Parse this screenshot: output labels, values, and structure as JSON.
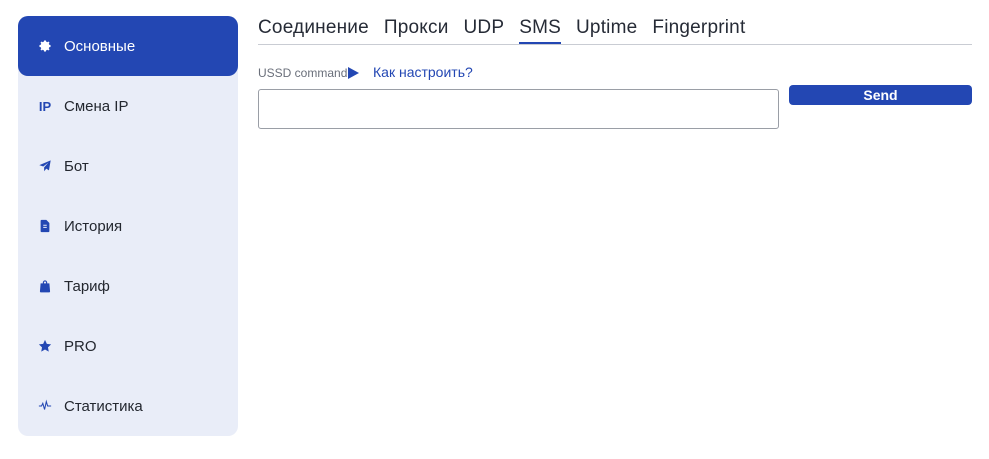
{
  "sidebar": {
    "items": [
      {
        "label": "Основные",
        "icon": "gear-icon",
        "active": true
      },
      {
        "label": "Смена IP",
        "icon": "ip-icon",
        "icon_text": "IP",
        "active": false
      },
      {
        "label": "Бот",
        "icon": "paper-plane-icon",
        "active": false
      },
      {
        "label": "История",
        "icon": "document-icon",
        "active": false
      },
      {
        "label": "Тариф",
        "icon": "shopping-bag-icon",
        "active": false
      },
      {
        "label": "PRO",
        "icon": "star-icon",
        "active": false
      },
      {
        "label": "Статистика",
        "icon": "activity-icon",
        "active": false
      }
    ]
  },
  "tabs": [
    {
      "label": "Соединение",
      "active": false
    },
    {
      "label": "Прокси",
      "active": false
    },
    {
      "label": "UDP",
      "active": false
    },
    {
      "label": "SMS",
      "active": true
    },
    {
      "label": "Uptime",
      "active": false
    },
    {
      "label": "Fingerprint",
      "active": false
    }
  ],
  "ussd": {
    "label": "USSD command",
    "help_link": "Как настроить?",
    "value": "",
    "send_label": "Send"
  },
  "colors": {
    "accent": "#2347b3",
    "sidebar_bg": "#e9edf8"
  }
}
